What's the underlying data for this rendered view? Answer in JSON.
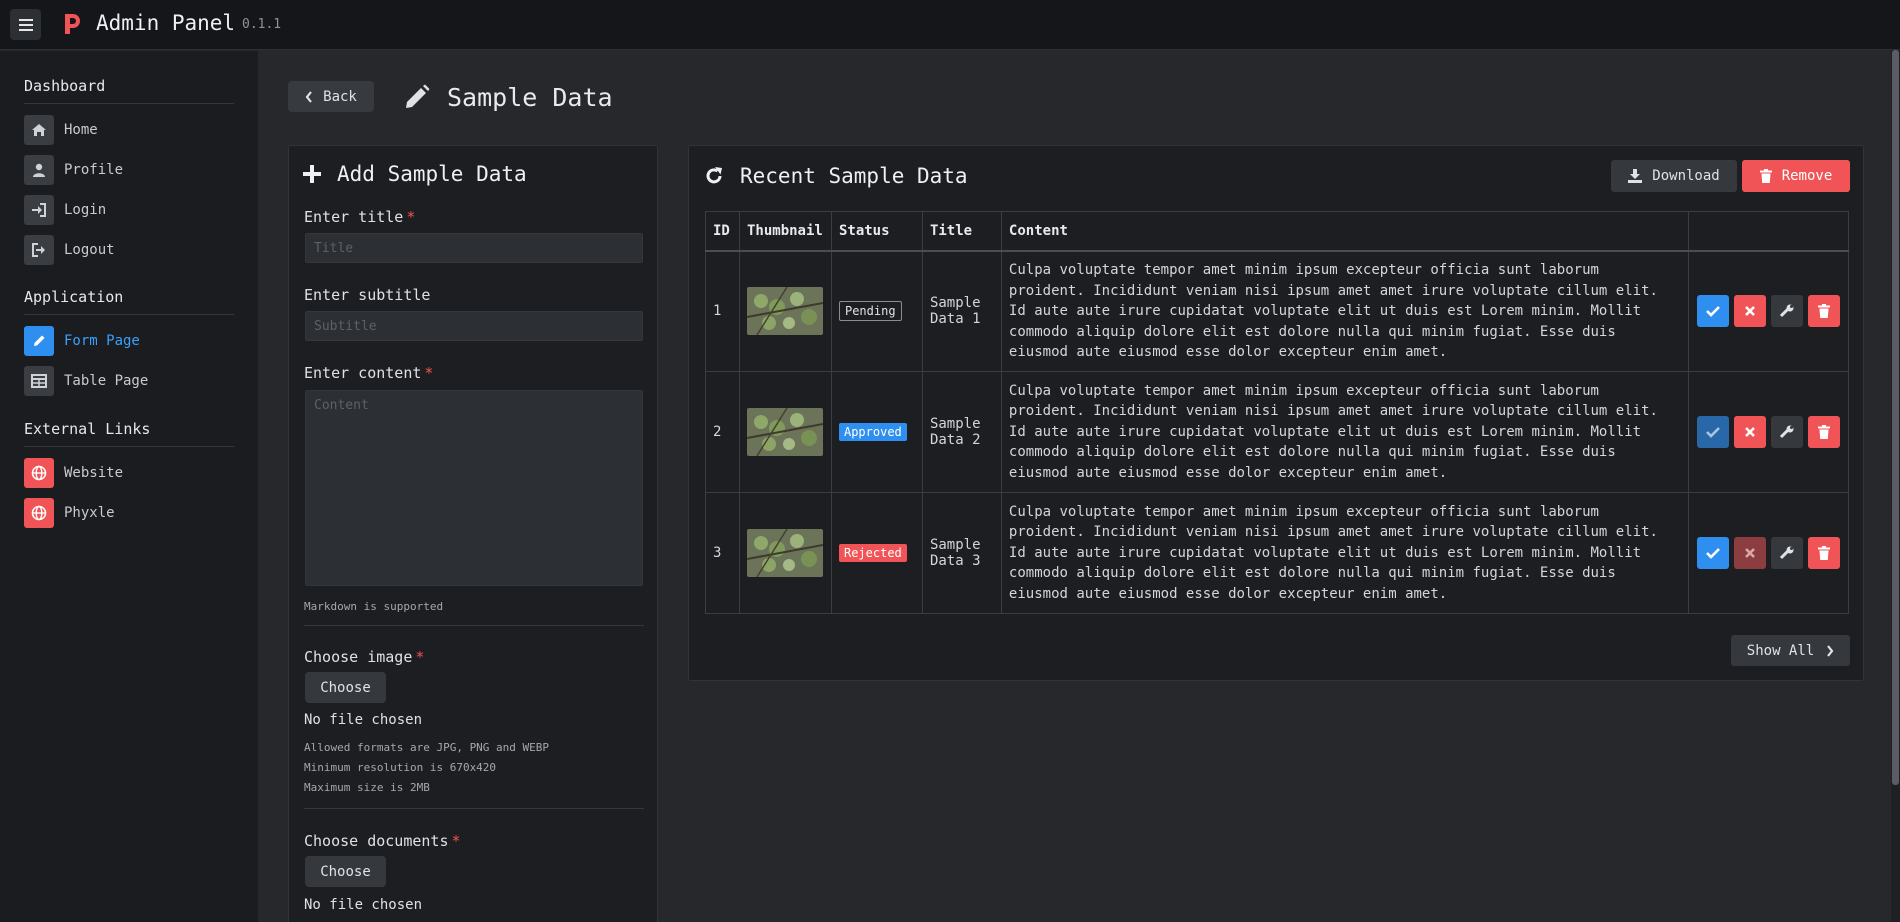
{
  "topbar": {
    "title": "Admin Panel",
    "version": "0.1.1"
  },
  "sidebar": {
    "sections": [
      {
        "heading": "Dashboard",
        "items": [
          {
            "label": "Home",
            "icon": "home-icon"
          },
          {
            "label": "Profile",
            "icon": "user-icon"
          },
          {
            "label": "Login",
            "icon": "login-icon"
          },
          {
            "label": "Logout",
            "icon": "logout-icon"
          }
        ]
      },
      {
        "heading": "Application",
        "items": [
          {
            "label": "Form Page",
            "icon": "pencil-icon",
            "active": true
          },
          {
            "label": "Table Page",
            "icon": "table-icon"
          }
        ]
      },
      {
        "heading": "External Links",
        "items": [
          {
            "label": "Website",
            "icon": "globe-icon"
          },
          {
            "label": "Phyxle",
            "icon": "globe-icon"
          }
        ]
      }
    ]
  },
  "header": {
    "back_label": "Back",
    "page_title": "Sample Data"
  },
  "form": {
    "title": "Add Sample Data",
    "title_label": "Enter title",
    "title_placeholder": "Title",
    "subtitle_label": "Enter subtitle",
    "subtitle_placeholder": "Subtitle",
    "content_label": "Enter content",
    "content_placeholder": "Content",
    "content_hint": "Markdown is supported",
    "image_label": "Choose image",
    "choose_label": "Choose",
    "no_file": "No file chosen",
    "image_hints": [
      "Allowed formats are JPG, PNG and WEBP",
      "Minimum resolution is 670x420",
      "Maximum size is 2MB"
    ],
    "documents_label": "Choose documents",
    "required_mark": "*"
  },
  "recent": {
    "title": "Recent Sample Data",
    "download_label": "Download",
    "remove_label": "Remove",
    "show_all_label": "Show All",
    "columns": [
      "ID",
      "Thumbnail",
      "Status",
      "Title",
      "Content",
      ""
    ],
    "rows": [
      {
        "id": "1",
        "status": "Pending",
        "status_kind": "pending",
        "title": "Sample Data 1",
        "content": "Culpa voluptate tempor amet minim ipsum excepteur officia sunt laborum proident. Incididunt veniam nisi ipsum amet amet irure voluptate cillum elit. Id aute aute irure cupidatat voluptate elit ut duis est Lorem minim. Mollit commodo aliquip dolore elit est dolore nulla qui minim fugiat. Esse duis eiusmod aute eiusmod esse dolor excepteur enim amet."
      },
      {
        "id": "2",
        "status": "Approved",
        "status_kind": "approved",
        "title": "Sample Data 2",
        "content": "Culpa voluptate tempor amet minim ipsum excepteur officia sunt laborum proident. Incididunt veniam nisi ipsum amet amet irure voluptate cillum elit. Id aute aute irure cupidatat voluptate elit ut duis est Lorem minim. Mollit commodo aliquip dolore elit est dolore nulla qui minim fugiat. Esse duis eiusmod aute eiusmod esse dolor excepteur enim amet."
      },
      {
        "id": "3",
        "status": "Rejected",
        "status_kind": "rejected",
        "title": "Sample Data 3",
        "content": "Culpa voluptate tempor amet minim ipsum excepteur officia sunt laborum proident. Incididunt veniam nisi ipsum amet amet irure voluptate cillum elit. Id aute aute irure cupidatat voluptate elit ut duis est Lorem minim. Mollit commodo aliquip dolore elit est dolore nulla qui minim fugiat. Esse duis eiusmod aute eiusmod esse dolor excepteur enim amet."
      }
    ]
  },
  "colors": {
    "accent": "#2f8ff0",
    "danger": "#f05456",
    "background": "#26282c",
    "sidebar": "#1a1c1f"
  }
}
